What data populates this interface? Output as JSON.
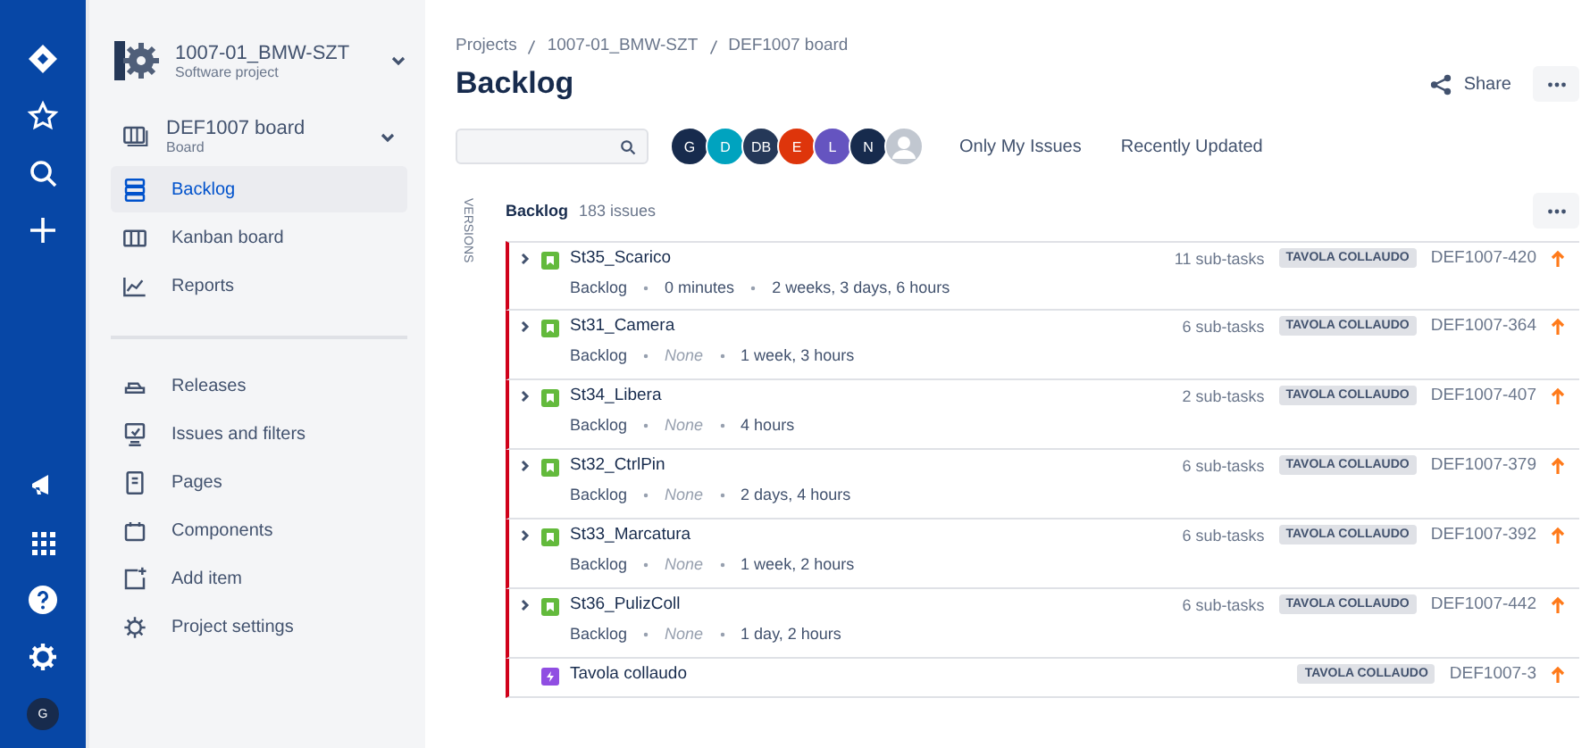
{
  "global_nav": {
    "user_initial": "G"
  },
  "project": {
    "name": "1007-01_BMW-SZT",
    "type": "Software project"
  },
  "board": {
    "name": "DEF1007 board",
    "type": "Board"
  },
  "sidebar": {
    "items": [
      {
        "label": "Backlog",
        "selected": true
      },
      {
        "label": "Kanban board",
        "selected": false
      },
      {
        "label": "Reports",
        "selected": false
      },
      {
        "label": "Releases",
        "selected": false
      },
      {
        "label": "Issues and filters",
        "selected": false
      },
      {
        "label": "Pages",
        "selected": false
      },
      {
        "label": "Components",
        "selected": false
      },
      {
        "label": "Add item",
        "selected": false
      },
      {
        "label": "Project settings",
        "selected": false
      }
    ]
  },
  "breadcrumbs": [
    "Projects",
    "1007-01_BMW-SZT",
    "DEF1007 board"
  ],
  "title": "Backlog",
  "share": "Share",
  "avatars": [
    {
      "initials": "G",
      "color": "#172b4d"
    },
    {
      "initials": "D",
      "color": "#00a3bf"
    },
    {
      "initials": "DB",
      "color": "#253858"
    },
    {
      "initials": "E",
      "color": "#de350b"
    },
    {
      "initials": "L",
      "color": "#6554c0"
    },
    {
      "initials": "N",
      "color": "#172b4d"
    },
    {
      "kind": "anonymous",
      "color": "#c1c7d0"
    }
  ],
  "filters": [
    "Only My Issues",
    "Recently Updated"
  ],
  "versions_label": "VERSIONS",
  "backlog": {
    "title": "Backlog",
    "count": "183 issues",
    "issues": [
      {
        "kind": "story",
        "title": "St35_Scarico",
        "status": "Backlog",
        "estimate": "0 minutes",
        "estimate_empty": false,
        "time": "2 weeks, 3 days, 6 hours",
        "subtasks": "11 sub-tasks",
        "epic": "TAVOLA COLLAUDO",
        "key": "DEF1007-420"
      },
      {
        "kind": "story",
        "title": "St31_Camera",
        "status": "Backlog",
        "estimate": "None",
        "estimate_empty": true,
        "time": "1 week, 3 hours",
        "subtasks": "6 sub-tasks",
        "epic": "TAVOLA COLLAUDO",
        "key": "DEF1007-364"
      },
      {
        "kind": "story",
        "title": "St34_Libera",
        "status": "Backlog",
        "estimate": "None",
        "estimate_empty": true,
        "time": "4 hours",
        "subtasks": "2 sub-tasks",
        "epic": "TAVOLA COLLAUDO",
        "key": "DEF1007-407"
      },
      {
        "kind": "story",
        "title": "St32_CtrlPin",
        "status": "Backlog",
        "estimate": "None",
        "estimate_empty": true,
        "time": "2 days, 4 hours",
        "subtasks": "6 sub-tasks",
        "epic": "TAVOLA COLLAUDO",
        "key": "DEF1007-379"
      },
      {
        "kind": "story",
        "title": "St33_Marcatura",
        "status": "Backlog",
        "estimate": "None",
        "estimate_empty": true,
        "time": "1 week, 2 hours",
        "subtasks": "6 sub-tasks",
        "epic": "TAVOLA COLLAUDO",
        "key": "DEF1007-392"
      },
      {
        "kind": "story",
        "title": "St36_PulizColl",
        "status": "Backlog",
        "estimate": "None",
        "estimate_empty": true,
        "time": "1 day, 2 hours",
        "subtasks": "6 sub-tasks",
        "epic": "TAVOLA COLLAUDO",
        "key": "DEF1007-442"
      },
      {
        "kind": "epic",
        "title": "Tavola collaudo",
        "epic": "TAVOLA COLLAUDO",
        "key": "DEF1007-3"
      }
    ]
  }
}
